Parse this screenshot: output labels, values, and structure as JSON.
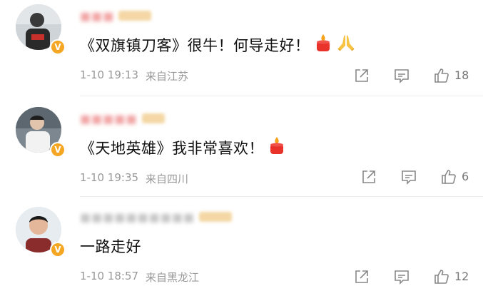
{
  "comments": [
    {
      "text": "《双旗镇刀客》很牛！何导走好！",
      "emojis": [
        "candle-emoji",
        "praying-hands-emoji"
      ],
      "time": "1-10 19:13",
      "location": "来自江苏",
      "likes": "18",
      "verified_badge": "V"
    },
    {
      "text": "《天地英雄》我非常喜欢！",
      "emojis": [
        "candle-emoji"
      ],
      "time": "1-10 19:35",
      "location": "来自四川",
      "likes": "6",
      "verified_badge": "V"
    },
    {
      "text": "一路走好",
      "emojis": [],
      "time": "1-10 18:57",
      "location": "来自黑龙江",
      "likes": "12",
      "verified_badge": "V"
    }
  ],
  "icons": {
    "share": "share-icon",
    "comment": "comment-icon",
    "like": "thumbs-up-icon"
  },
  "colors": {
    "verified_badge": "#f5a623",
    "meta_text": "#999999",
    "icon_stroke": "#888888",
    "candle_red": "#e8322a",
    "flame_orange": "#f7a21b",
    "hands_yellow": "#f6c343"
  }
}
